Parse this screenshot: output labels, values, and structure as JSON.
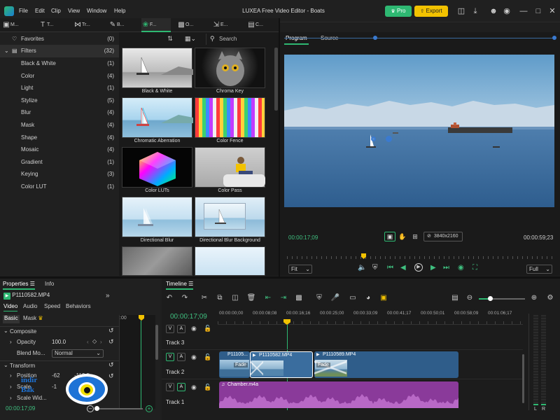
{
  "app": {
    "title": "LUXEA Free Video Editor - Boats",
    "menu": [
      "File",
      "Edit",
      "Clip",
      "View",
      "Window",
      "Help"
    ],
    "pro_label": "Pro",
    "export_label": "Export",
    "accent": "#2eb872",
    "export_color": "#f2c200"
  },
  "tabs": [
    {
      "label": "M...",
      "icon": "media-icon"
    },
    {
      "label": "T...",
      "icon": "text-icon"
    },
    {
      "label": "Tr...",
      "icon": "transition-icon"
    },
    {
      "label": "B...",
      "icon": "brush-icon"
    },
    {
      "label": "F...",
      "icon": "filters-icon",
      "active": true
    },
    {
      "label": "O...",
      "icon": "overlay-icon"
    },
    {
      "label": "E...",
      "icon": "effects-icon"
    },
    {
      "label": "C...",
      "icon": "captions-icon"
    }
  ],
  "favorites": {
    "label": "Favorites",
    "count": "(0)"
  },
  "filters": {
    "label": "Filters",
    "count": "(32)"
  },
  "categories": [
    {
      "label": "Black & White",
      "count": "(1)"
    },
    {
      "label": "Color",
      "count": "(4)"
    },
    {
      "label": "Light",
      "count": "(1)"
    },
    {
      "label": "Stylize",
      "count": "(5)"
    },
    {
      "label": "Blur",
      "count": "(4)"
    },
    {
      "label": "Mask",
      "count": "(4)"
    },
    {
      "label": "Shape",
      "count": "(4)"
    },
    {
      "label": "Mosaic",
      "count": "(4)"
    },
    {
      "label": "Gradient",
      "count": "(1)"
    },
    {
      "label": "Keying",
      "count": "(3)"
    },
    {
      "label": "Color LUT",
      "count": "(1)"
    }
  ],
  "search": {
    "placeholder": "Search"
  },
  "thumbnails": [
    {
      "label": "Black & White"
    },
    {
      "label": "Chroma Key"
    },
    {
      "label": "Chromatic Aberration"
    },
    {
      "label": "Color Fence"
    },
    {
      "label": "Color LUTs"
    },
    {
      "label": "Color Pass"
    },
    {
      "label": "Directional Blur"
    },
    {
      "label": "Directional Blur Background"
    }
  ],
  "monitor": {
    "tabs": [
      "Program",
      "Source"
    ],
    "current_time": "00:00:17;09",
    "total_time": "00:00:59;23",
    "resolution": "3840x2160",
    "fit": "Fit",
    "quality": "Full"
  },
  "properties": {
    "tabs": [
      "Properties",
      "Info"
    ],
    "clip_name": "P1110582.MP4",
    "subtabs": [
      "Video",
      "Audio",
      "Speed",
      "Behaviors"
    ],
    "modes": [
      "Basic",
      "Mask"
    ],
    "sections": {
      "composite": "Composite",
      "opacity_label": "Opacity",
      "opacity_value": "100.0",
      "blend_label": "Blend Mo...",
      "blend_value": "Normal",
      "transform": "Transform",
      "position_label": "Position",
      "position_x": "-62",
      "position_y": "-119.5",
      "scale_label": "Scale",
      "scale_value": "-1",
      "scale_width_label": "Scale Wid..."
    },
    "time": "00:00:17;09",
    "ruler_label": ":00"
  },
  "timeline": {
    "title": "Timeline",
    "current_time": "00:00:17;09",
    "ruler": [
      "00:00:00;00",
      "00:00:08;08",
      "00:00:16;16",
      "00:00:25;00",
      "00:00:33;09",
      "00:00:41;17",
      "00:00:50;01",
      "00:00:58;09",
      "00:01:06;17"
    ],
    "tracks": [
      "Track 3",
      "Track 2",
      "Track 1"
    ],
    "clips": [
      {
        "label": "P11105...",
        "fade": "Fade"
      },
      {
        "label": "P1110582.MP4",
        "fade": ""
      },
      {
        "label": "P1110589.MP4",
        "fade": "Fade"
      }
    ],
    "audio_clip": "Chamber.m4a",
    "meter_left": "L",
    "meter_right": "R",
    "v_label": "V",
    "a_label": "A"
  },
  "watermark": {
    "text": "indir Bak"
  }
}
